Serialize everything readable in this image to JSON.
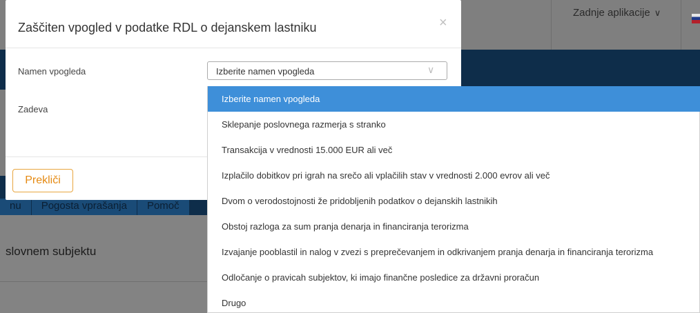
{
  "background": {
    "apps_menu_label": "Zadnje aplikacije",
    "tabs": [
      "nu",
      "Pogosta vprašanja",
      "Pomoč"
    ],
    "subject_heading": "slovnem subjektu"
  },
  "modal": {
    "title": "Zaščiten vpogled v podatke RDL o dejanskem lastniku",
    "close_symbol": "×",
    "fields": {
      "purpose_label": "Namen vpogleda",
      "case_label": "Zadeva"
    },
    "select": {
      "value": "Izberite namen vpogleda"
    },
    "cancel_label": "Prekliči"
  },
  "dropdown": {
    "options": [
      "Izberite namen vpogleda",
      "Sklepanje poslovnega razmerja s stranko",
      "Transakcija v vrednosti 15.000 EUR ali več",
      "Izplačilo dobitkov pri igrah na srečo ali vplačilih stav v vrednosti 2.000 evrov ali več",
      "Dvom o verodostojnosti že pridobljenih podatkov o dejanskih lastnikih",
      "Obstoj razloga za sum pranja denarja in financiranja terorizma",
      "Izvajanje pooblastil in nalog v zvezi s preprečevanjem in odkrivanjem pranja denarja in financiranja terorizma",
      "Odločanje o pravicah subjektov, ki imajo finančne posledice za državni proračun",
      "Drugo"
    ],
    "selected_index": 0
  },
  "colors": {
    "highlight": "#3e8fd9",
    "cancel_accent": "#e58a12",
    "nav_dark": "#0e2d4a"
  }
}
